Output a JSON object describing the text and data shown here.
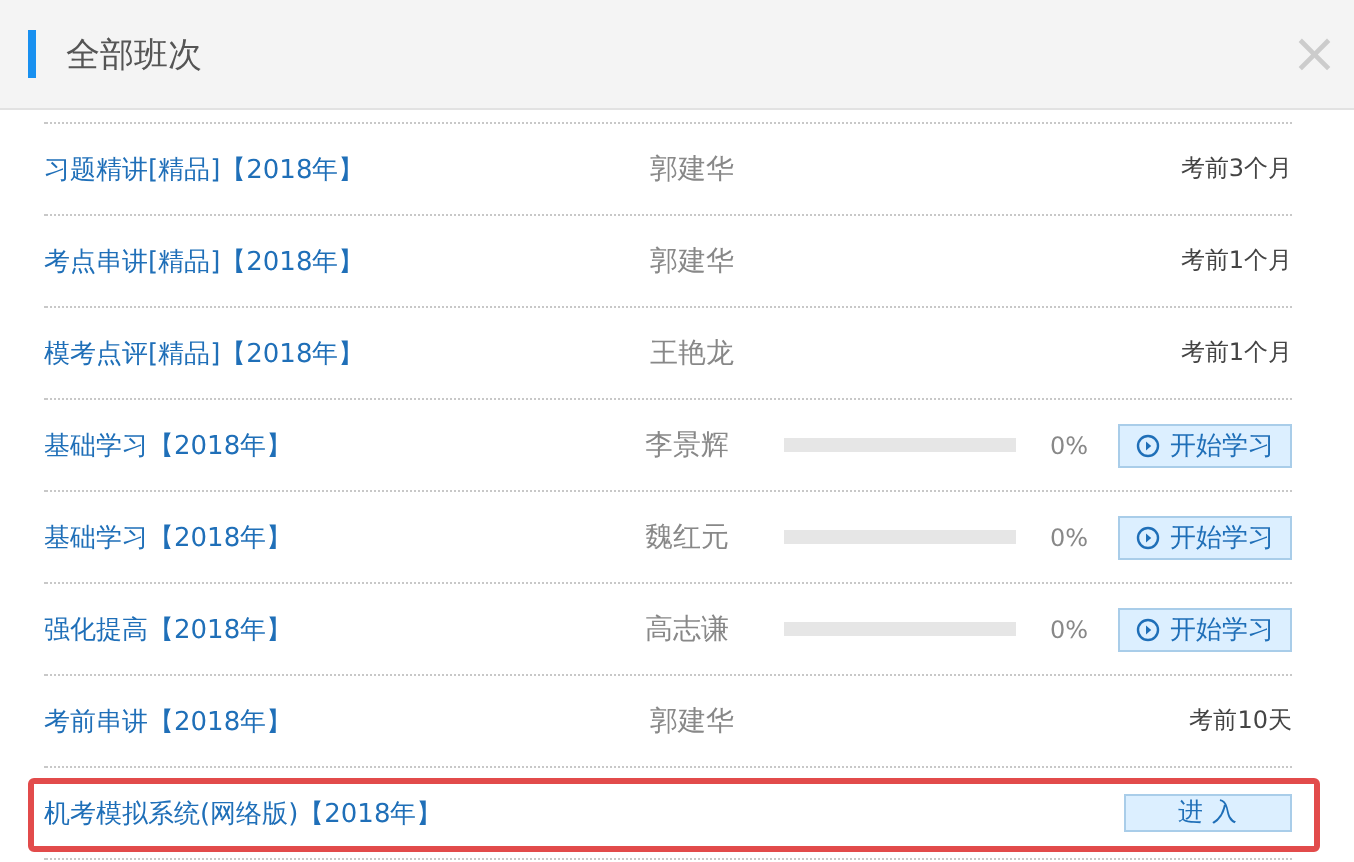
{
  "dialog": {
    "title": "全部班次",
    "close": "×"
  },
  "rows": [
    {
      "kind": "countdown",
      "course": "习题精讲[精品]【2018年】",
      "teacher": "郭建华",
      "note": "考前3个月",
      "highlighted": false
    },
    {
      "kind": "countdown",
      "course": "考点串讲[精品]【2018年】",
      "teacher": "郭建华",
      "note": "考前1个月",
      "highlighted": false
    },
    {
      "kind": "countdown",
      "course": "模考点评[精品]【2018年】",
      "teacher": "王艳龙",
      "note": "考前1个月",
      "highlighted": false
    },
    {
      "kind": "progress",
      "course": "基础学习【2018年】",
      "teacher": "李景辉",
      "percent": "0%",
      "button": "开始学习",
      "highlighted": false
    },
    {
      "kind": "progress",
      "course": "基础学习【2018年】",
      "teacher": "魏红元",
      "percent": "0%",
      "button": "开始学习",
      "highlighted": false
    },
    {
      "kind": "progress",
      "course": "强化提高【2018年】",
      "teacher": "高志谦",
      "percent": "0%",
      "button": "开始学习",
      "highlighted": false
    },
    {
      "kind": "countdown",
      "course": "考前串讲【2018年】",
      "teacher": "郭建华",
      "note": "考前10天",
      "highlighted": false
    },
    {
      "kind": "enter",
      "course": "机考模拟系统(网络版)【2018年】",
      "button": "进 入",
      "highlighted": true
    }
  ]
}
